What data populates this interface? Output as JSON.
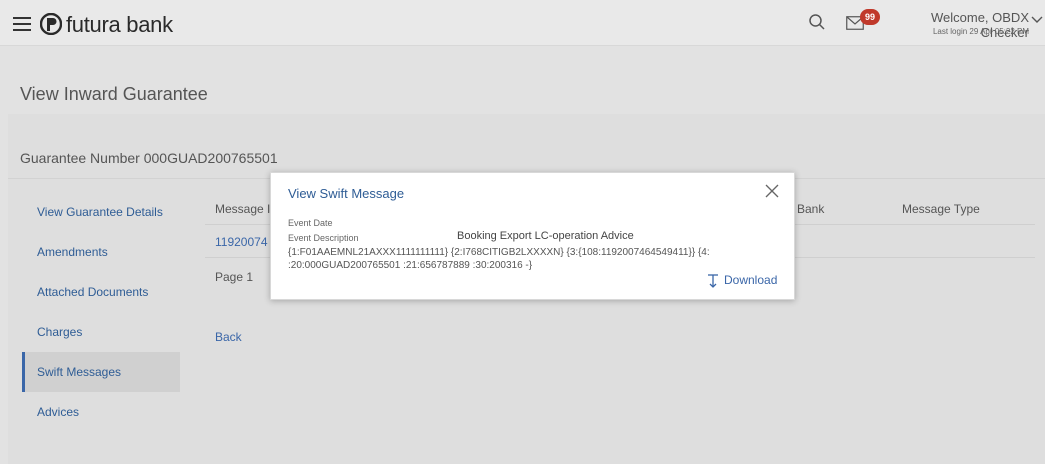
{
  "header": {
    "brand": "futura bank",
    "notification_count": "99",
    "welcome": "Welcome, OBDX Checker",
    "last_login": "Last login 29 Apr 05:22 PM"
  },
  "page": {
    "title": "View Inward Guarantee",
    "guarantee_number": "Guarantee Number 000GUAD200765501"
  },
  "sidebar": {
    "items": [
      {
        "label": "View Guarantee Details"
      },
      {
        "label": "Amendments"
      },
      {
        "label": "Attached Documents"
      },
      {
        "label": "Charges"
      },
      {
        "label": "Swift Messages",
        "active": true
      },
      {
        "label": "Advices"
      }
    ]
  },
  "table": {
    "headers": {
      "message": "Message I",
      "bank": "Bank",
      "message_type": "Message Type"
    },
    "row_ref": "11920074",
    "page_label": "Page  1",
    "back": "Back"
  },
  "modal": {
    "title": "View Swift Message",
    "event_date_label": "Event Date",
    "event_description_label": "Event Description",
    "event_description_value": "Booking Export LC-operation Advice",
    "swift_line1": "{1:F01AAEMNL21AXXX1111111111} {2:I768CITIGB2LXXXXN} {3:{108:1192007464549411}} {4:",
    "swift_line2": ":20:000GUAD200765501 :21:656787889 :30:200316 -}",
    "download": "Download"
  },
  "colors": {
    "accent": "#3a66a8",
    "badge": "#c0392b"
  }
}
